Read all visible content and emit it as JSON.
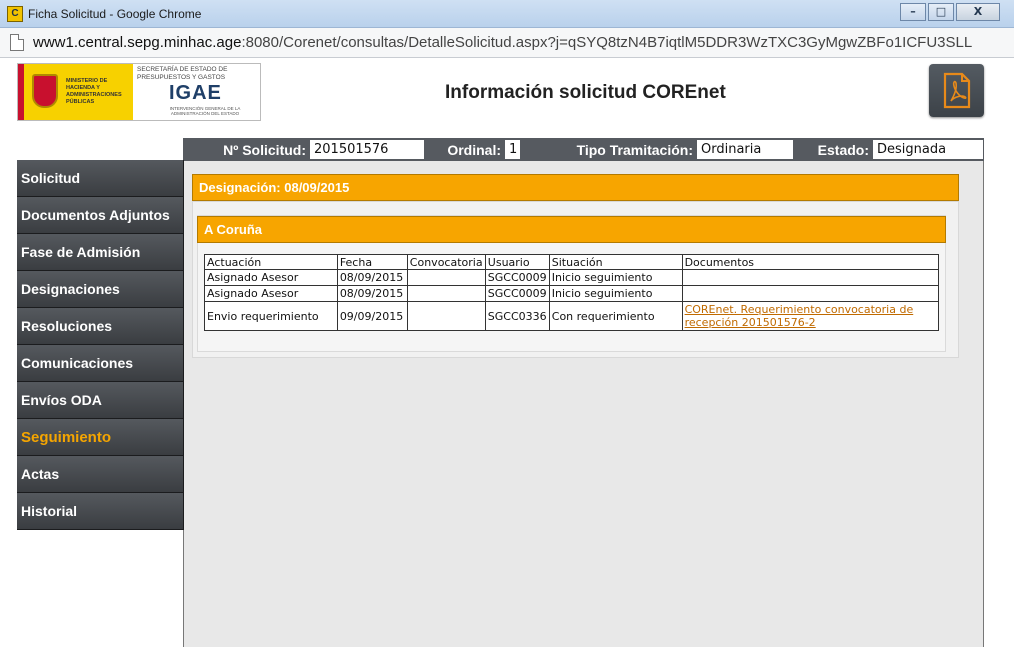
{
  "window": {
    "title": "Ficha Solicitud - Google Chrome",
    "url_host": "www1.central.sepg.minhac.age",
    "url_rest": ":8080/Corenet/consultas/DetalleSolicitud.aspx?j=qSYQ8tzN4B7iqtlM5DDR3WzTXC3GyMgwZBFo1ICFU3SLL"
  },
  "logo": {
    "ministry": "MINISTERIO DE HACIENDA Y ADMINISTRACIONES PÚBLICAS",
    "secretaria": "SECRETARÍA DE ESTADO DE PRESUPUESTOS Y GASTOS",
    "igae": "IGAE",
    "igae_sub": "INTERVENCIÓN GENERAL DE LA ADMINISTRACIÓN DEL ESTADO"
  },
  "page_title": "Información solicitud COREnet",
  "info": {
    "solicitud_label": "Nº Solicitud:",
    "solicitud_value": "201501576",
    "ordinal_label": "Ordinal:",
    "ordinal_value": "1",
    "tipo_label": "Tipo Tramitación:",
    "tipo_value": "Ordinaria",
    "estado_label": "Estado:",
    "estado_value": "Designada"
  },
  "sidebar": {
    "items": [
      {
        "label": "Solicitud"
      },
      {
        "label": "Documentos Adjuntos"
      },
      {
        "label": "Fase de Admisión"
      },
      {
        "label": "Designaciones"
      },
      {
        "label": "Resoluciones"
      },
      {
        "label": "Comunicaciones"
      },
      {
        "label": "Envíos ODA"
      },
      {
        "label": "Seguimiento"
      },
      {
        "label": "Actas"
      },
      {
        "label": "Historial"
      }
    ],
    "active": "Seguimiento"
  },
  "designacion": {
    "header": "Designación: 08/09/2015",
    "province": "A Coruña"
  },
  "table": {
    "headers": [
      "Actuación",
      "Fecha",
      "Convocatoria",
      "Usuario",
      "Situación",
      "Documentos"
    ],
    "rows": [
      [
        "Asignado Asesor",
        "08/09/2015",
        "",
        "SGCC0009",
        "Inicio seguimiento",
        ""
      ],
      [
        "Asignado Asesor",
        "08/09/2015",
        "",
        "SGCC0009",
        "Inicio seguimiento",
        ""
      ],
      [
        "Envio requerimiento",
        "09/09/2015",
        "",
        "SGCC0336",
        "Con requerimiento",
        "COREnet. Requerimiento convocatoria de recepción 201501576-2"
      ]
    ]
  },
  "colors": {
    "accent": "#f7a500",
    "nav_bg": "#45494e",
    "info_bar": "#565a60"
  },
  "icons": {
    "pdf": "pdf-icon",
    "page": "page-icon"
  }
}
